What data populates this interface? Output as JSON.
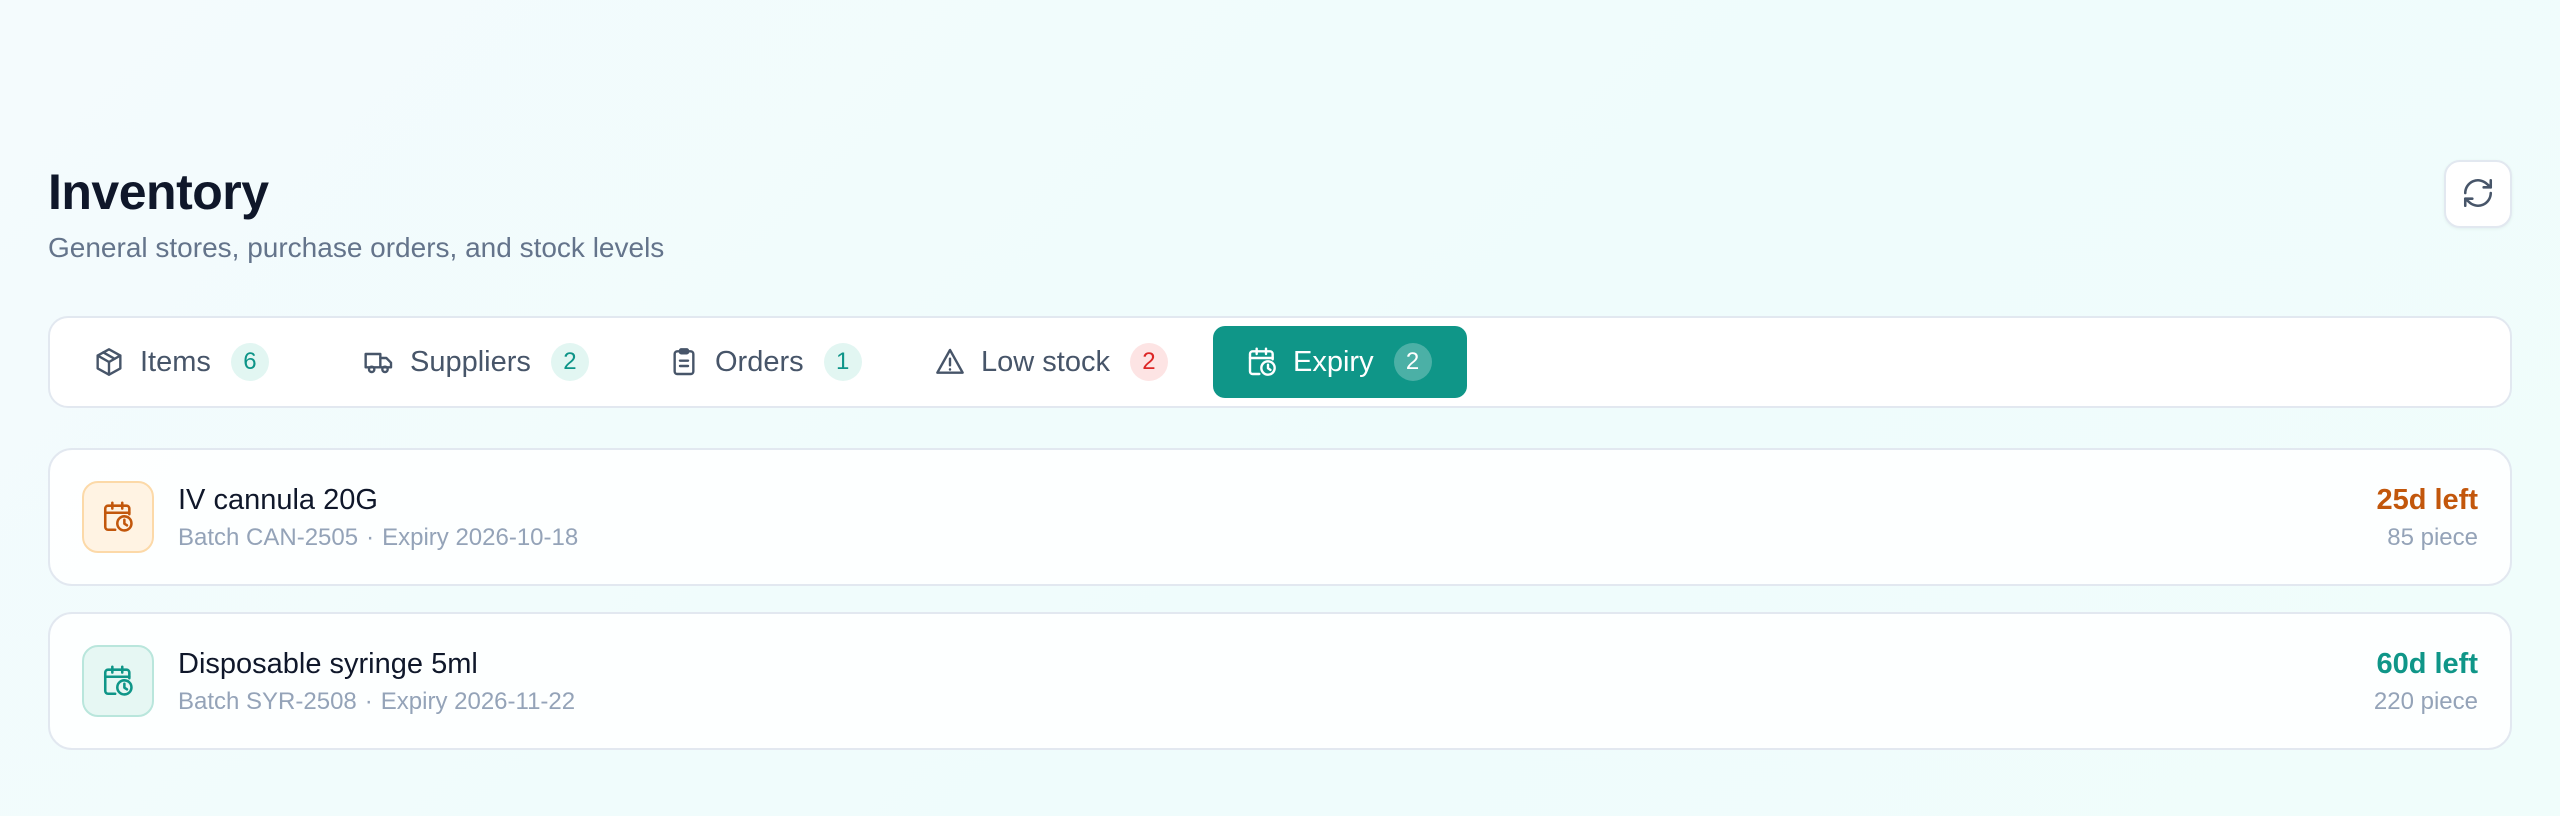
{
  "header": {
    "title": "Inventory",
    "subtitle": "General stores, purchase orders, and stock levels"
  },
  "refresh": {
    "icon": "refresh-icon"
  },
  "tabs": [
    {
      "label": "Items",
      "count": "6",
      "icon": "package-icon",
      "count_color": "#0d9488",
      "active": false
    },
    {
      "label": "Suppliers",
      "count": "2",
      "icon": "truck-icon",
      "count_color": "#0d9488",
      "active": false
    },
    {
      "label": "Orders",
      "count": "1",
      "icon": "clipboard-icon",
      "count_color": "#0d9488",
      "active": false
    },
    {
      "label": "Low stock",
      "count": "2",
      "icon": "warning-icon",
      "count_color": "#dc2626",
      "active": false
    },
    {
      "label": "Expiry",
      "count": "2",
      "icon": "calendar-clock-icon",
      "count_color": "#ffffff",
      "active": true
    }
  ],
  "items": [
    {
      "name": "IV cannula 20G",
      "batch": "Batch CAN-2505",
      "expiry": "Expiry 2026-10-18",
      "days_left": "25d left",
      "quantity": "85 piece",
      "status_color": "#c2570c",
      "icon": "calendar-clock-icon"
    },
    {
      "name": "Disposable syringe 5ml",
      "batch": "Batch SYR-2508",
      "expiry": "Expiry 2026-11-22",
      "days_left": "60d left",
      "quantity": "220 piece",
      "status_color": "#0f9688",
      "icon": "calendar-clock-icon"
    }
  ],
  "meta_separator": "·",
  "colors": {
    "accent": "#0f9688",
    "warning": "#c2570c",
    "danger": "#dc2626"
  }
}
